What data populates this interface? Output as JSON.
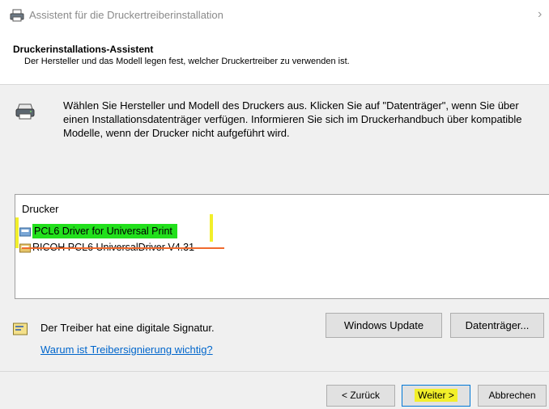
{
  "window": {
    "title": "Assistent für die Druckertreiberinstallation",
    "close_glyph": "›"
  },
  "header": {
    "title": "Druckerinstallations-Assistent",
    "subtitle": "Der Hersteller und das Modell legen fest, welcher Druckertreiber zu verwenden ist."
  },
  "body": {
    "icon": "printer-icon",
    "description": "Wählen Sie Hersteller und Modell des Druckers aus. Klicken Sie auf \"Datenträger\", wenn Sie über einen Installationsdatenträger verfügen. Informieren Sie sich im Druckerhandbuch über kompatible Modelle, wenn der Drucker nicht aufgeführt wird."
  },
  "printer_list": {
    "header": "Drucker",
    "items": [
      {
        "label": "PCL6 Driver for Universal Print",
        "selected": true,
        "highlight": "#22e01c"
      },
      {
        "label": "RICOH PCL6 UniversalDriver V4.31",
        "struck_out": true,
        "strike_color": "#f06a2e"
      }
    ]
  },
  "signature": {
    "text": "Der Treiber hat eine digitale Signatur.",
    "link": "Warum ist Treibersignierung wichtig?"
  },
  "buttons": {
    "windows_update": "Windows Update",
    "datentraeger": "Datenträger...",
    "back": "< Zurück",
    "next": "Weiter >",
    "cancel": "Abbrechen"
  },
  "colors": {
    "link": "#0066cc",
    "highlight_yellow": "#f2ef2a",
    "highlight_green": "#22e01c",
    "default_button_border": "#0078d7"
  }
}
